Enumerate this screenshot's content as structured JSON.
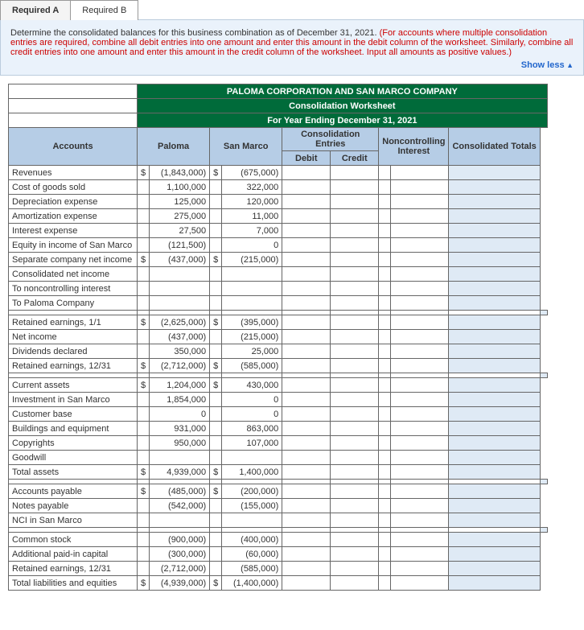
{
  "tabs": {
    "a": "Required A",
    "b": "Required B"
  },
  "instr": {
    "black": "Determine the consolidated balances for this business combination as of December 31, 2021. ",
    "red": "(For accounts where multiple consolidation entries are required, combine all debit entries into one amount and enter this amount in the debit column of the worksheet. Similarly, combine all credit entries into one amount and enter this amount in the credit column of the worksheet. Input all amounts as positive values.)",
    "showless": "Show less"
  },
  "title1": "PALOMA CORPORATION AND SAN MARCO COMPANY",
  "title2": "Consolidation Worksheet",
  "title3": "For Year Ending December 31, 2021",
  "hdr": {
    "accounts": "Accounts",
    "paloma": "Paloma",
    "sanmarco": "San Marco",
    "consol": "Consolidation Entries",
    "debit": "Debit",
    "credit": "Credit",
    "nci": "Noncontrolling Interest",
    "totals": "Consolidated Totals"
  },
  "rows": {
    "r1": {
      "a": "Revenues",
      "ps": "$",
      "p": "(1,843,000)",
      "ss": "$",
      "s": "(675,000)"
    },
    "r2": {
      "a": "Cost of goods sold",
      "p": "1,100,000",
      "s": "322,000"
    },
    "r3": {
      "a": "Depreciation expense",
      "p": "125,000",
      "s": "120,000"
    },
    "r4": {
      "a": "Amortization expense",
      "p": "275,000",
      "s": "11,000"
    },
    "r5": {
      "a": "Interest expense",
      "p": "27,500",
      "s": "7,000"
    },
    "r6": {
      "a": "Equity in income of San Marco",
      "p": "(121,500)",
      "s": "0"
    },
    "r7": {
      "a": "Separate company net income",
      "ps": "$",
      "p": "(437,000)",
      "ss": "$",
      "s": "(215,000)"
    },
    "r8": {
      "a": "Consolidated net income"
    },
    "r9": {
      "a": "To noncontrolling interest"
    },
    "r10": {
      "a": "To Paloma Company"
    },
    "r11": {
      "a": "Retained earnings, 1/1",
      "ps": "$",
      "p": "(2,625,000)",
      "ss": "$",
      "s": "(395,000)"
    },
    "r12": {
      "a": "Net income",
      "p": "(437,000)",
      "s": "(215,000)"
    },
    "r13": {
      "a": "Dividends declared",
      "p": "350,000",
      "s": "25,000"
    },
    "r14": {
      "a": "Retained earnings, 12/31",
      "ps": "$",
      "p": "(2,712,000)",
      "ss": "$",
      "s": "(585,000)"
    },
    "r15": {
      "a": "Current assets",
      "ps": "$",
      "p": "1,204,000",
      "ss": "$",
      "s": "430,000"
    },
    "r16": {
      "a": "Investment in San Marco",
      "p": "1,854,000",
      "s": "0"
    },
    "r17": {
      "a": "Customer base",
      "p": "0",
      "s": "0"
    },
    "r18": {
      "a": "Buildings and equipment",
      "p": "931,000",
      "s": "863,000"
    },
    "r19": {
      "a": "Copyrights",
      "p": "950,000",
      "s": "107,000"
    },
    "r20": {
      "a": "Goodwill"
    },
    "r21": {
      "a": "Total assets",
      "ps": "$",
      "p": "4,939,000",
      "ss": "$",
      "s": "1,400,000"
    },
    "r22": {
      "a": "Accounts payable",
      "ps": "$",
      "p": "(485,000)",
      "ss": "$",
      "s": "(200,000)"
    },
    "r23": {
      "a": "Notes payable",
      "p": "(542,000)",
      "s": "(155,000)"
    },
    "r24": {
      "a": "NCI in San Marco"
    },
    "r25": {
      "a": "Common stock",
      "p": "(900,000)",
      "s": "(400,000)"
    },
    "r26": {
      "a": "Additional paid-in capital",
      "p": "(300,000)",
      "s": "(60,000)"
    },
    "r27": {
      "a": "Retained earnings, 12/31",
      "p": "(2,712,000)",
      "s": "(585,000)"
    },
    "r28": {
      "a": "Total liabilities and equities",
      "ps": "$",
      "p": "(4,939,000)",
      "ss": "$",
      "s": "(1,400,000)"
    }
  }
}
